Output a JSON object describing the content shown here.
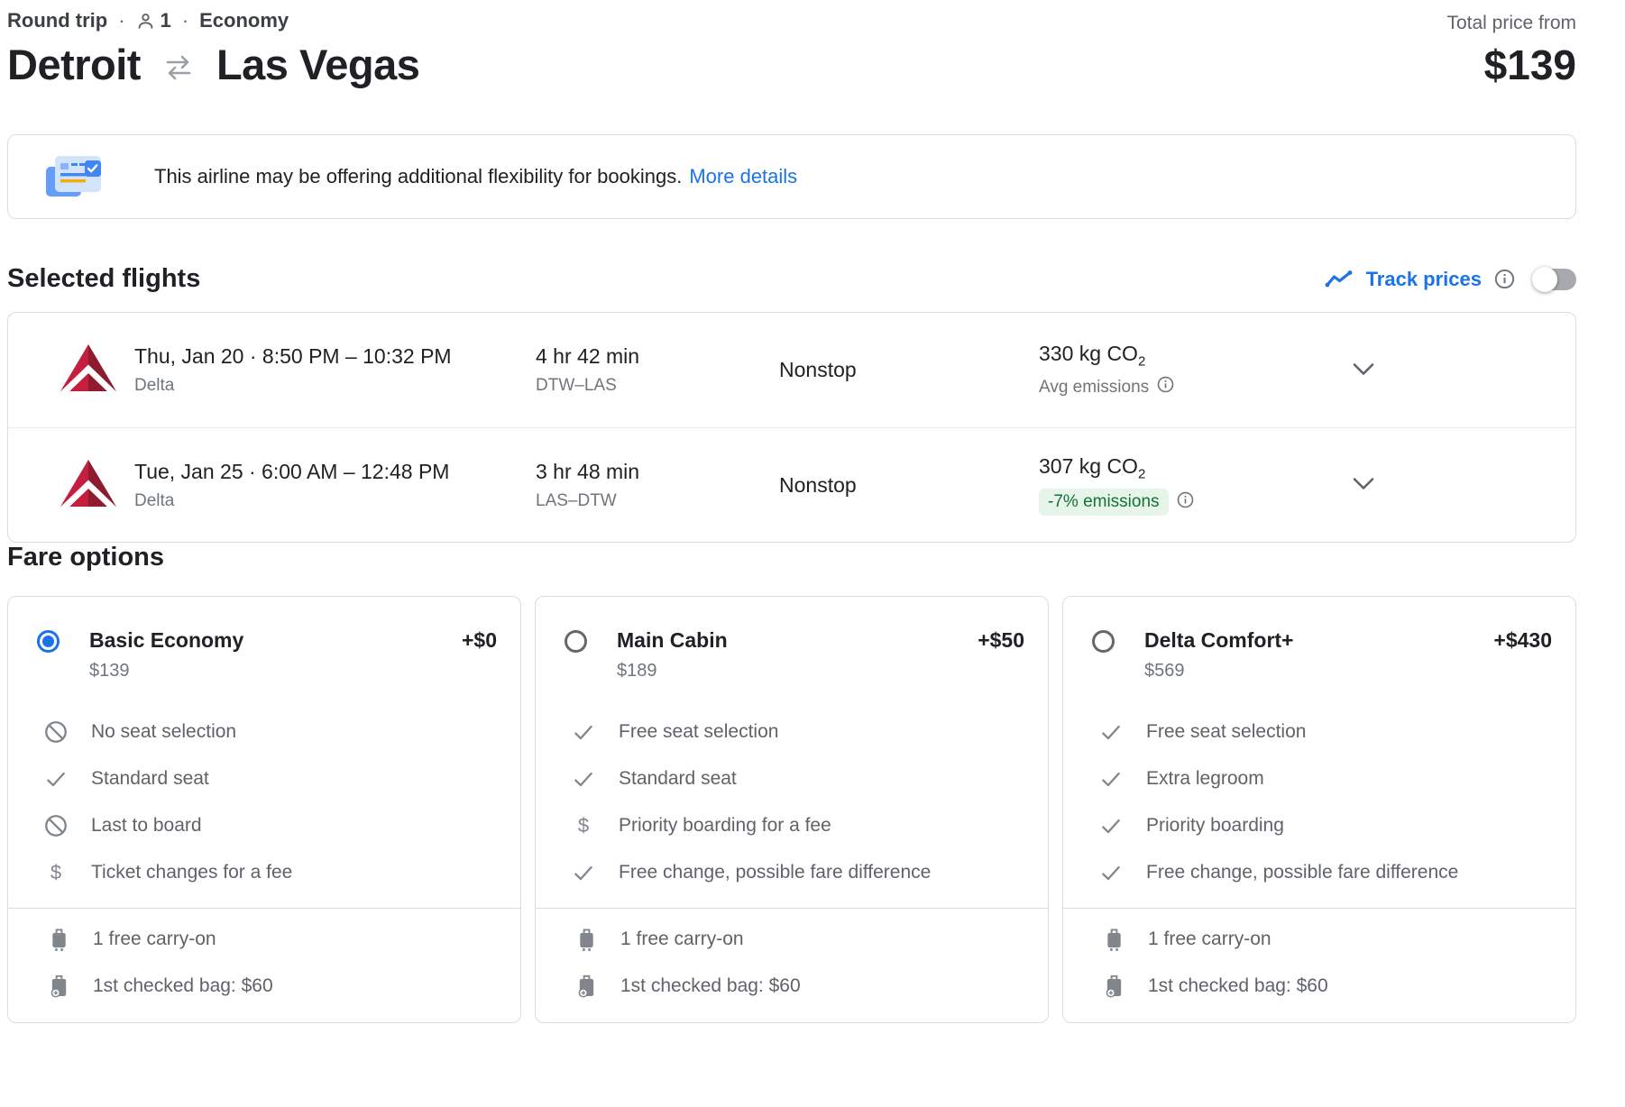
{
  "header": {
    "trip_type": "Round trip",
    "separator": "·",
    "passenger_count": "1",
    "cabin_class": "Economy",
    "origin": "Detroit",
    "destination": "Las Vegas",
    "total_price_label": "Total price from",
    "total_price": "$139"
  },
  "banner": {
    "icon": "flexibility-doc",
    "message": "This airline may be offering additional flexibility for bookings.",
    "link_label": "More details"
  },
  "selected_flights": {
    "title": "Selected flights",
    "track_prices_label": "Track prices",
    "track_prices_enabled": "off",
    "flights": [
      {
        "airline": "Delta",
        "date_time": "Thu, Jan 20 · 8:50 PM – 10:32 PM",
        "duration": "4 hr 42 min",
        "route": "DTW–LAS",
        "stops": "Nonstop",
        "co2": "330 kg CO",
        "co2_sub": "2",
        "emissions_note": "Avg emissions"
      },
      {
        "airline": "Delta",
        "date_time": "Tue, Jan 25 · 6:00 AM – 12:48 PM",
        "duration": "3 hr 48 min",
        "route": "LAS–DTW",
        "stops": "Nonstop",
        "co2": "307 kg CO",
        "co2_sub": "2",
        "emissions_badge": "-7% emissions"
      }
    ]
  },
  "fare_options": {
    "title": "Fare options",
    "cards": [
      {
        "name": "Basic Economy",
        "price": "$139",
        "delta_price": "+$0",
        "selected": true,
        "features": [
          {
            "icon": "ban",
            "text": "No seat selection"
          },
          {
            "icon": "check",
            "text": "Standard seat"
          },
          {
            "icon": "ban",
            "text": "Last to board"
          },
          {
            "icon": "dollar",
            "text": "Ticket changes for a fee"
          }
        ],
        "baggage": [
          {
            "icon": "carry-on",
            "text": "1 free carry-on"
          },
          {
            "icon": "checked-bag",
            "text": "1st checked bag: $60"
          }
        ]
      },
      {
        "name": "Main Cabin",
        "price": "$189",
        "delta_price": "+$50",
        "selected": false,
        "features": [
          {
            "icon": "check",
            "text": "Free seat selection"
          },
          {
            "icon": "check",
            "text": "Standard seat"
          },
          {
            "icon": "dollar",
            "text": "Priority boarding for a fee"
          },
          {
            "icon": "check",
            "text": "Free change, possible fare difference"
          }
        ],
        "baggage": [
          {
            "icon": "carry-on",
            "text": "1 free carry-on"
          },
          {
            "icon": "checked-bag",
            "text": "1st checked bag: $60"
          }
        ]
      },
      {
        "name": "Delta Comfort+",
        "price": "$569",
        "delta_price": "+$430",
        "selected": false,
        "features": [
          {
            "icon": "check",
            "text": "Free seat selection"
          },
          {
            "icon": "check",
            "text": "Extra legroom"
          },
          {
            "icon": "check",
            "text": "Priority boarding"
          },
          {
            "icon": "check",
            "text": "Free change, possible fare difference"
          }
        ],
        "baggage": [
          {
            "icon": "carry-on",
            "text": "1 free carry-on"
          },
          {
            "icon": "checked-bag",
            "text": "1st checked bag: $60"
          }
        ]
      }
    ]
  },
  "colors": {
    "accent_blue": "#1a73e8",
    "text_primary": "#202124",
    "text_secondary": "#5f6368",
    "border": "#dadce0",
    "emissions_badge_bg": "#e6f4ea",
    "emissions_badge_text": "#137333",
    "delta_red_light": "#c51f3f",
    "delta_red_dark": "#8f1b2f"
  }
}
